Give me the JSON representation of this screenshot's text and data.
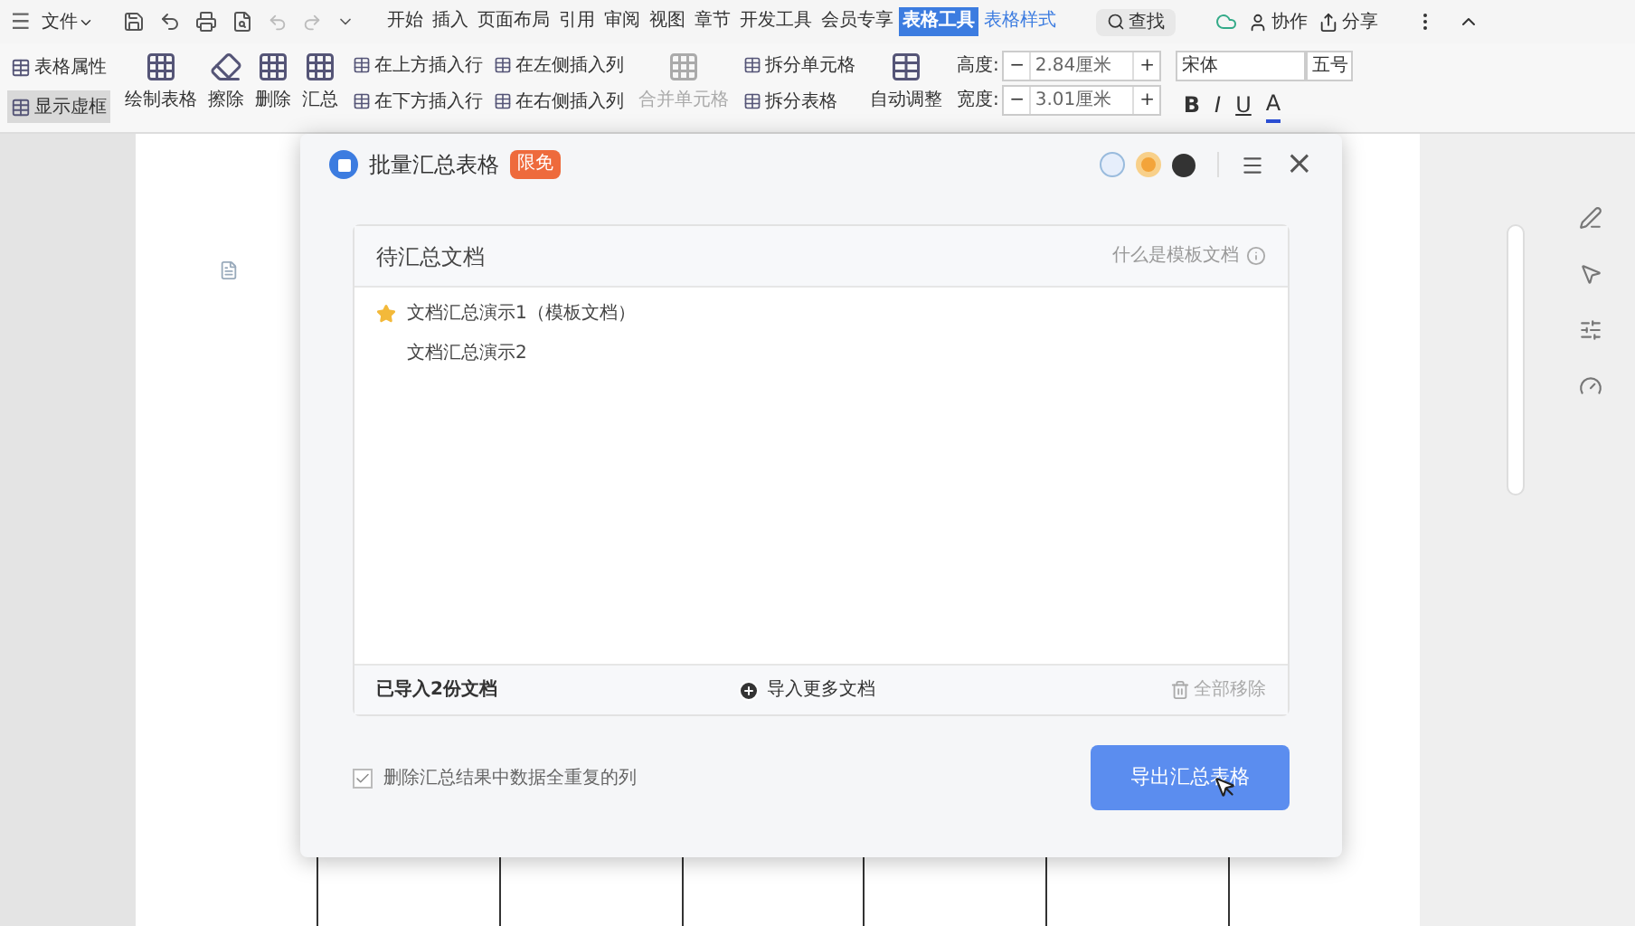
{
  "menu": {
    "hamburger": "☰",
    "file": "文件",
    "tabs": [
      {
        "label": "开始",
        "selected": false,
        "contextual": false
      },
      {
        "label": "插入",
        "selected": false,
        "contextual": false
      },
      {
        "label": "页面布局",
        "selected": false,
        "contextual": false
      },
      {
        "label": "引用",
        "selected": false,
        "contextual": false
      },
      {
        "label": "审阅",
        "selected": false,
        "contextual": false
      },
      {
        "label": "视图",
        "selected": false,
        "contextual": false
      },
      {
        "label": "章节",
        "selected": false,
        "contextual": false
      },
      {
        "label": "开发工具",
        "selected": false,
        "contextual": false
      },
      {
        "label": "会员专享",
        "selected": false,
        "contextual": false
      },
      {
        "label": "表格工具",
        "selected": true,
        "contextual": true
      },
      {
        "label": "表格样式",
        "selected": false,
        "contextual": true
      }
    ],
    "search": "查找",
    "actions": [
      "协作",
      "分享"
    ]
  },
  "ribbon": {
    "toggles": [
      {
        "label": "表格属性",
        "selected": false
      },
      {
        "label": "显示虚框",
        "selected": true
      }
    ],
    "big_buttons": [
      "绘制表格",
      "擦除",
      "删除",
      "汇总"
    ],
    "insert": [
      "在上方插入行",
      "在左侧插入列",
      "在下方插入行",
      "在右侧插入列"
    ],
    "merge": "合并单元格",
    "split": [
      "拆分单元格",
      "拆分表格"
    ],
    "autofit": "自动调整",
    "sizes": [
      {
        "label": "高度:",
        "value": "2.84厘米"
      },
      {
        "label": "宽度:",
        "value": "3.01厘米"
      }
    ],
    "minus": "−",
    "plus": "+",
    "font": "宋体",
    "font_size": "五号",
    "format": [
      "B",
      "I",
      "U",
      "A"
    ]
  },
  "dialog": {
    "title": "批量汇总表格",
    "badge": "限免",
    "close": "×",
    "list": {
      "title": "待汇总文档",
      "help": "什么是模板文档",
      "items": [
        {
          "name": "文档汇总演示1（模板文档）",
          "template": true
        },
        {
          "name": "文档汇总演示2",
          "template": false
        }
      ],
      "count": "已导入2份文档",
      "import": "导入更多文档",
      "remove": "全部移除"
    },
    "option": {
      "label": "删除汇总结果中数据全重复的列",
      "checked": true
    },
    "export": "导出汇总表格"
  }
}
